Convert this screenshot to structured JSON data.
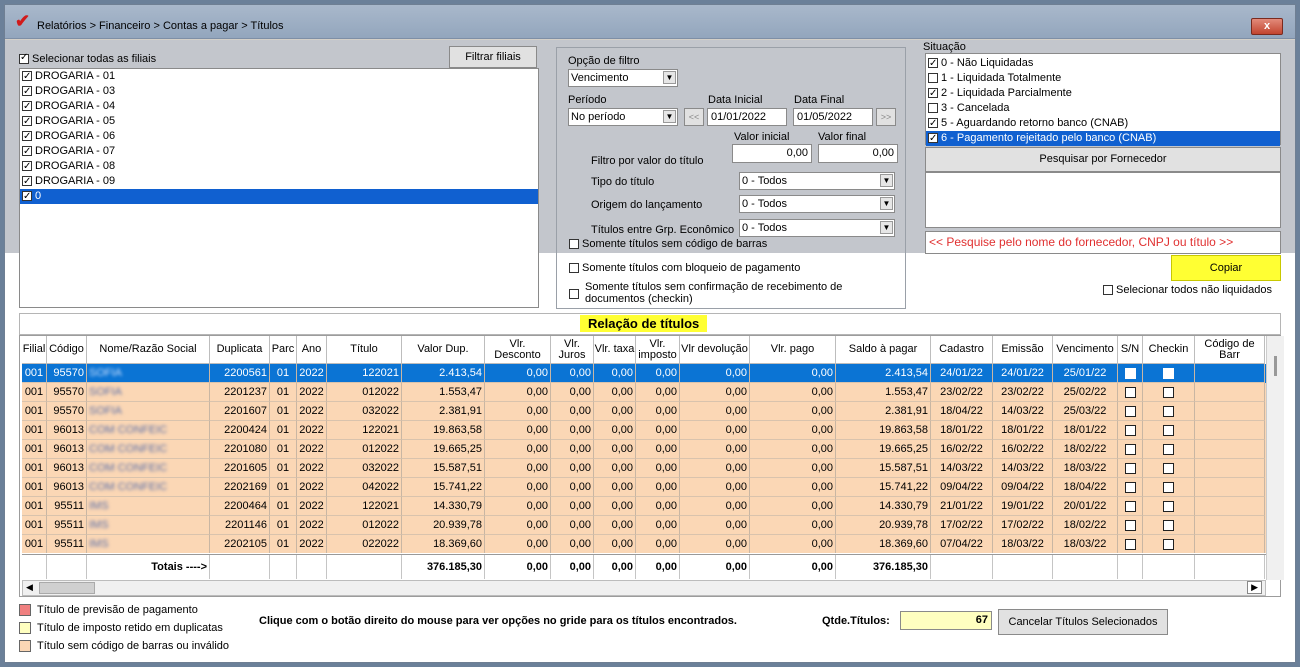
{
  "window": {
    "title": "Relatórios > Financeiro > Contas a pagar > Títulos",
    "close_label": "x"
  },
  "filiais": {
    "select_all_label": "Selecionar todas as filiais",
    "filter_button": "Filtrar filiais",
    "items": [
      "DROGARIA - 01",
      "DROGARIA - 03",
      "DROGARIA - 04",
      "DROGARIA - 05",
      "DROGARIA - 06",
      "DROGARIA - 07",
      "DROGARIA - 08",
      "DROGARIA - 09",
      "0"
    ]
  },
  "filter": {
    "group_label": "Opção de filtro",
    "option_value": "Vencimento",
    "period_label": "Período",
    "period_value": "No período",
    "prev_label": "<<",
    "next_label": ">>",
    "date_start_label": "Data Inicial",
    "date_start": "01/01/2022",
    "date_end_label": "Data Final",
    "date_end": "01/05/2022",
    "value_start_label": "Valor inicial",
    "value_end_label": "Valor final",
    "value_filter_label": "Filtro por valor do título",
    "value_start": "0,00",
    "value_end": "0,00",
    "tipo_label": "Tipo do título",
    "tipo_value": "0 - Todos",
    "origem_label": "Origem do lançamento",
    "origem_value": "0 - Todos",
    "grupo_label": "Títulos entre Grp. Econômico",
    "grupo_value": "0 - Todos",
    "check_barcode": "Somente títulos sem código de barras",
    "check_block": "Somente títulos com bloqueio de pagamento",
    "check_confirm": "Somente títulos sem confirmação de recebimento de documentos (checkin)"
  },
  "situacao": {
    "label": "Situação",
    "items": [
      {
        "label": "0 - Não Liquidadas",
        "checked": true
      },
      {
        "label": "1 - Liquidada Totalmente",
        "checked": false
      },
      {
        "label": "2 - Liquidada Parcialmente",
        "checked": true
      },
      {
        "label": "3 - Cancelada",
        "checked": false
      },
      {
        "label": "5 - Aguardando retorno banco (CNAB)",
        "checked": true
      },
      {
        "label": "6 - Pagamento rejeitado pelo banco (CNAB)",
        "checked": true
      }
    ],
    "search_supplier_button": "Pesquisar por Fornecedor",
    "search_hint": "<< Pesquise pelo nome do fornecedor, CNPJ ou título >>",
    "copy_button": "Copiar",
    "select_unpaid": "Selecionar todos não liquidados"
  },
  "grid": {
    "title": "Relação de títulos",
    "headers": [
      "Filial",
      "Código",
      "Nome/Razão Social",
      "Duplicata",
      "Parc",
      "Ano",
      "Título",
      "Valor Dup.",
      "Vlr. Desconto",
      "Vlr. Juros",
      "Vlr. taxa",
      "Vlr. imposto",
      "Vlr devolução",
      "Vlr. pago",
      "Saldo à pagar",
      "Cadastro",
      "Emissão",
      "Vencimento",
      "S/N",
      "Checkin",
      "Código de Barr"
    ],
    "rows": [
      [
        "001",
        "95570",
        "SOFIA",
        "2200561",
        "01",
        "2022",
        "122021",
        "2.413,54",
        "0,00",
        "0,00",
        "0,00",
        "0,00",
        "0,00",
        "0,00",
        "2.413,54",
        "24/01/22",
        "24/01/22",
        "25/01/22"
      ],
      [
        "001",
        "95570",
        "SOFIA",
        "2201237",
        "01",
        "2022",
        "012022",
        "1.553,47",
        "0,00",
        "0,00",
        "0,00",
        "0,00",
        "0,00",
        "0,00",
        "1.553,47",
        "23/02/22",
        "23/02/22",
        "25/02/22"
      ],
      [
        "001",
        "95570",
        "SOFIA",
        "2201607",
        "01",
        "2022",
        "032022",
        "2.381,91",
        "0,00",
        "0,00",
        "0,00",
        "0,00",
        "0,00",
        "0,00",
        "2.381,91",
        "18/04/22",
        "14/03/22",
        "25/03/22"
      ],
      [
        "001",
        "96013",
        "COM CONFEIC",
        "2200424",
        "01",
        "2022",
        "122021",
        "19.863,58",
        "0,00",
        "0,00",
        "0,00",
        "0,00",
        "0,00",
        "0,00",
        "19.863,58",
        "18/01/22",
        "18/01/22",
        "18/01/22"
      ],
      [
        "001",
        "96013",
        "COM CONFEIC",
        "2201080",
        "01",
        "2022",
        "012022",
        "19.665,25",
        "0,00",
        "0,00",
        "0,00",
        "0,00",
        "0,00",
        "0,00",
        "19.665,25",
        "16/02/22",
        "16/02/22",
        "18/02/22"
      ],
      [
        "001",
        "96013",
        "COM CONFEIC",
        "2201605",
        "01",
        "2022",
        "032022",
        "15.587,51",
        "0,00",
        "0,00",
        "0,00",
        "0,00",
        "0,00",
        "0,00",
        "15.587,51",
        "14/03/22",
        "14/03/22",
        "18/03/22"
      ],
      [
        "001",
        "96013",
        "COM CONFEIC",
        "2202169",
        "01",
        "2022",
        "042022",
        "15.741,22",
        "0,00",
        "0,00",
        "0,00",
        "0,00",
        "0,00",
        "0,00",
        "15.741,22",
        "09/04/22",
        "09/04/22",
        "18/04/22"
      ],
      [
        "001",
        "95511",
        "IMS",
        "2200464",
        "01",
        "2022",
        "122021",
        "14.330,79",
        "0,00",
        "0,00",
        "0,00",
        "0,00",
        "0,00",
        "0,00",
        "14.330,79",
        "21/01/22",
        "19/01/22",
        "20/01/22"
      ],
      [
        "001",
        "95511",
        "IMS",
        "2201146",
        "01",
        "2022",
        "012022",
        "20.939,78",
        "0,00",
        "0,00",
        "0,00",
        "0,00",
        "0,00",
        "0,00",
        "20.939,78",
        "17/02/22",
        "17/02/22",
        "18/02/22"
      ],
      [
        "001",
        "95511",
        "IMS",
        "2202105",
        "01",
        "2022",
        "022022",
        "18.369,60",
        "0,00",
        "0,00",
        "0,00",
        "0,00",
        "0,00",
        "0,00",
        "18.369,60",
        "07/04/22",
        "18/03/22",
        "18/03/22"
      ]
    ],
    "totals_label": "Totais ---->",
    "totals": {
      "valor_dup": "376.185,30",
      "desconto": "0,00",
      "juros": "0,00",
      "taxa": "0,00",
      "imposto": "0,00",
      "devolucao": "0,00",
      "pago": "0,00",
      "saldo": "376.185,30"
    }
  },
  "legend": {
    "items": [
      {
        "label": "Título de previsão de pagamento",
        "color": "#f08080"
      },
      {
        "label": "Título de imposto retido em duplicatas",
        "color": "#ffffc0"
      },
      {
        "label": "Título sem código de barras ou inválido",
        "color": "#fbd7b5"
      }
    ]
  },
  "footer": {
    "hint": "Clique com o botão direito do mouse para ver opções no gride para os títulos encontrados.",
    "count_label": "Qtde.Títulos:",
    "count_value": "67",
    "cancel_button": "Cancelar Títulos Selecionados"
  },
  "colors": {
    "selected_row": "#0b74d4",
    "row_bg": "#fbd7b5",
    "highlight": "#ffff33",
    "hint_red": "#e03030"
  }
}
